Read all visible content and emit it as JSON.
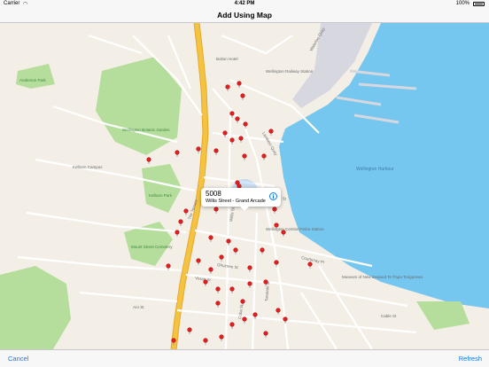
{
  "status_bar": {
    "carrier": "Carrier",
    "time": "4:42 PM",
    "battery": "100%"
  },
  "nav_bar": {
    "title": "Add Using Map"
  },
  "toolbar": {
    "cancel_label": "Cancel",
    "refresh_label": "Refresh"
  },
  "callout": {
    "stop_number": "5008",
    "stop_name": "Willis Street - Grand Arcade"
  },
  "map_labels": [
    "Bolton Hotel",
    "Anderson Park",
    "Wellington Botanic Garden",
    "Kelburn Park",
    "Wellington Harbour",
    "Museum of New Zealand Te Papa Tongarewa",
    "Wellington Central Police Station",
    "Mount Street Cemetery",
    "The Terrace",
    "Willis St",
    "Lambton Quay",
    "Taranaki St",
    "Courtenay Pl",
    "Cuba St",
    "Aro St",
    "Vivian St",
    "Ghuznee St",
    "Manners St",
    "Waterloo Quay",
    "Cable St",
    "Kelburn Campus",
    "Wellington Railway Station"
  ],
  "colors": {
    "accent": "#0a7aff",
    "water": "#75c7f0",
    "park": "#b5dd9c",
    "motorway": "#f4c342",
    "pin": "#e11d1d"
  }
}
